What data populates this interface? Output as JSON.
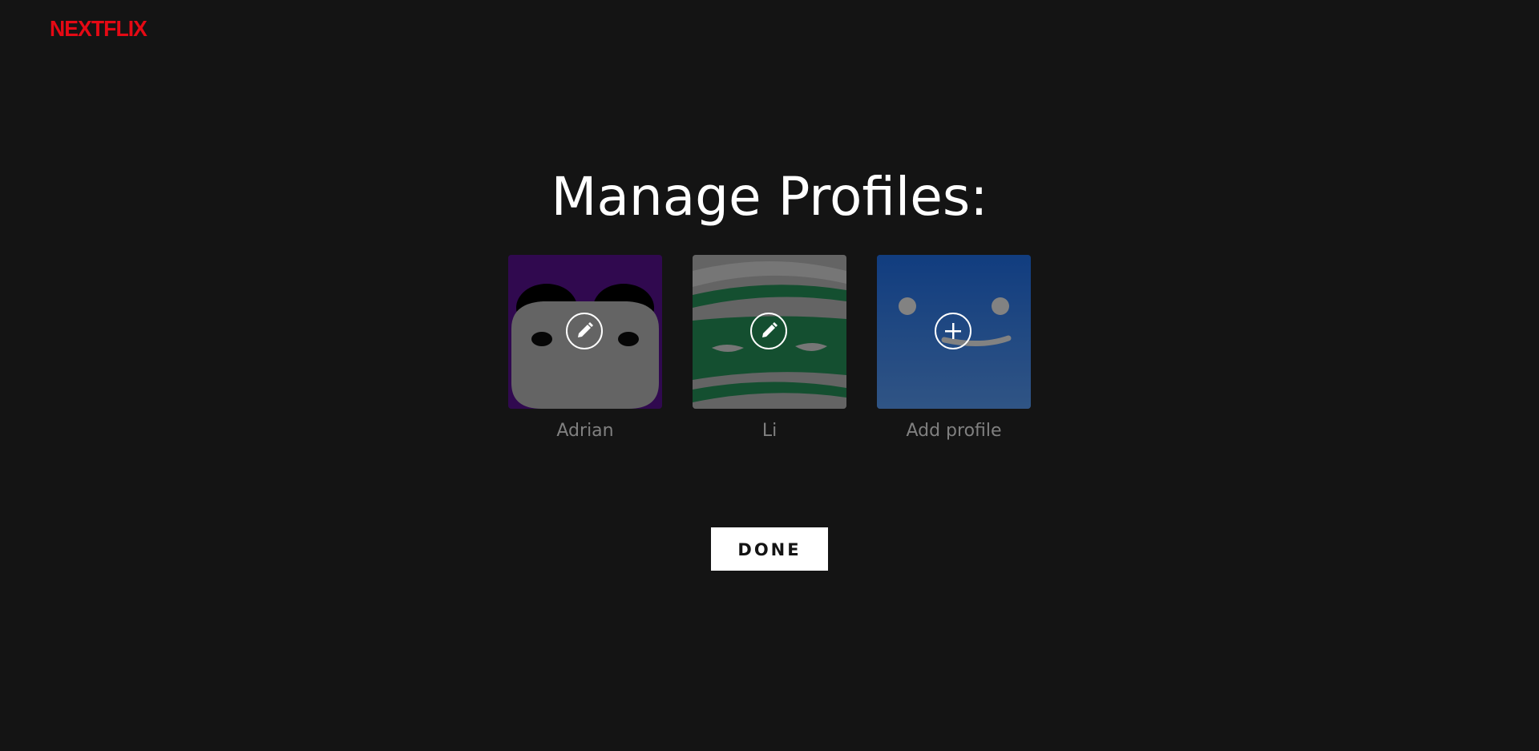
{
  "brand": {
    "logo_text": "NEXTFLIX",
    "color": "#e50914"
  },
  "page": {
    "title": "Manage Profiles:"
  },
  "profiles": [
    {
      "name": "Adrian",
      "avatar_color": "#4a0f7a",
      "action_icon": "pencil-icon"
    },
    {
      "name": "Li",
      "avatar_color": "#1f7a4a",
      "action_icon": "pencil-icon"
    },
    {
      "name": "Add profile",
      "avatar_color": "#1a4a8a",
      "action_icon": "plus-icon"
    }
  ],
  "actions": {
    "done_label": "DONE"
  },
  "colors": {
    "background": "#141414",
    "title": "#ffffff",
    "profile_name": "#808080"
  }
}
